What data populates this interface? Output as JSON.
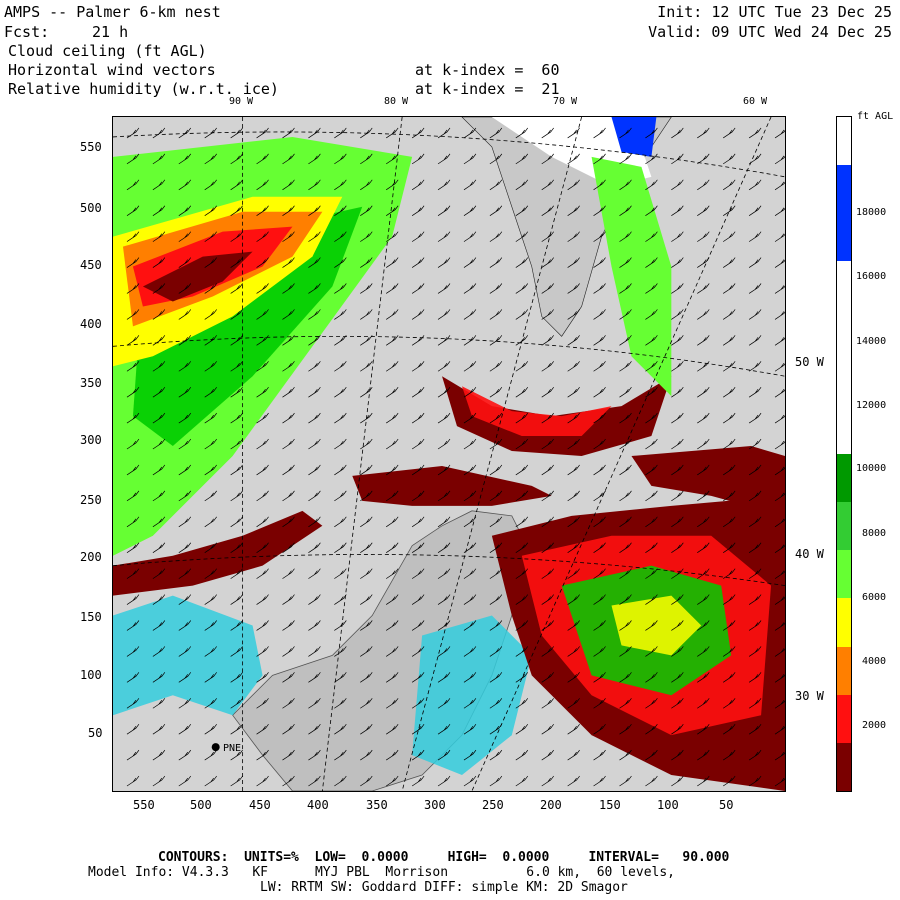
{
  "header": {
    "model": "AMPS -- Palmer 6-km nest",
    "fcst_label": "Fcst:",
    "fcst_value": "21 h",
    "init": "Init: 12 UTC Tue 23 Dec 25",
    "valid": "Valid: 09 UTC Wed 24 Dec 25",
    "field1": "Cloud ceiling (ft AGL)",
    "field2": "Horizontal wind vectors",
    "field2_level": "at k-index =  60",
    "field3": "Relative humidity (w.r.t. ice)",
    "field3_level": "at k-index =  21"
  },
  "map": {
    "top_lon_labels": [
      "90 W",
      "80 W",
      "70 W",
      "60 W"
    ],
    "right_lon_labels": [
      "50 W",
      "40 W",
      "30 W"
    ],
    "y_ticks": [
      "550",
      "500",
      "450",
      "400",
      "350",
      "300",
      "250",
      "200",
      "150",
      "100",
      "50"
    ],
    "x_ticks": [
      "550",
      "500",
      "450",
      "400",
      "350",
      "300",
      "250",
      "200",
      "150",
      "100",
      "50"
    ],
    "station_label": "PNE",
    "colors": {
      "background": "#d3d3d3",
      "land": "#bfbfbf",
      "dark_red": "#7a0000",
      "red": "#ff1010",
      "orange": "#ff7f00",
      "yellow": "#ffff00",
      "light_green": "#66ff33",
      "green": "#00cc00",
      "dark_green": "#009900",
      "cyan": "#33ccdd",
      "blue": "#0033ff",
      "white": "#ffffff"
    }
  },
  "legend": {
    "unit": "ft AGL",
    "labels": [
      "18000",
      "16000",
      "14000",
      "12000",
      "10000",
      "8000",
      "6000",
      "4000",
      "2000"
    ],
    "segments": [
      {
        "color": "#ffffff"
      },
      {
        "color": "#0033ff"
      },
      {
        "color": "#0033ff"
      },
      {
        "color": "#ffffff"
      },
      {
        "color": "#ffffff"
      },
      {
        "color": "#ffffff"
      },
      {
        "color": "#ffffff"
      },
      {
        "color": "#009900"
      },
      {
        "color": "#33cc33"
      },
      {
        "color": "#66ff33"
      },
      {
        "color": "#ffff00"
      },
      {
        "color": "#ff7f00"
      },
      {
        "color": "#ff1010"
      },
      {
        "color": "#7a0000"
      }
    ]
  },
  "footer": {
    "line1": "CONTOURS:  UNITS=%  LOW=  0.0000     HIGH=  0.0000     INTERVAL=   90.000",
    "line2": "Model Info: V4.3.3   KF      MYJ PBL  Morrison          6.0 km,  60 levels,",
    "line3": "LW: RRTM SW: Goddard DIFF: simple KM: 2D Smagor"
  }
}
